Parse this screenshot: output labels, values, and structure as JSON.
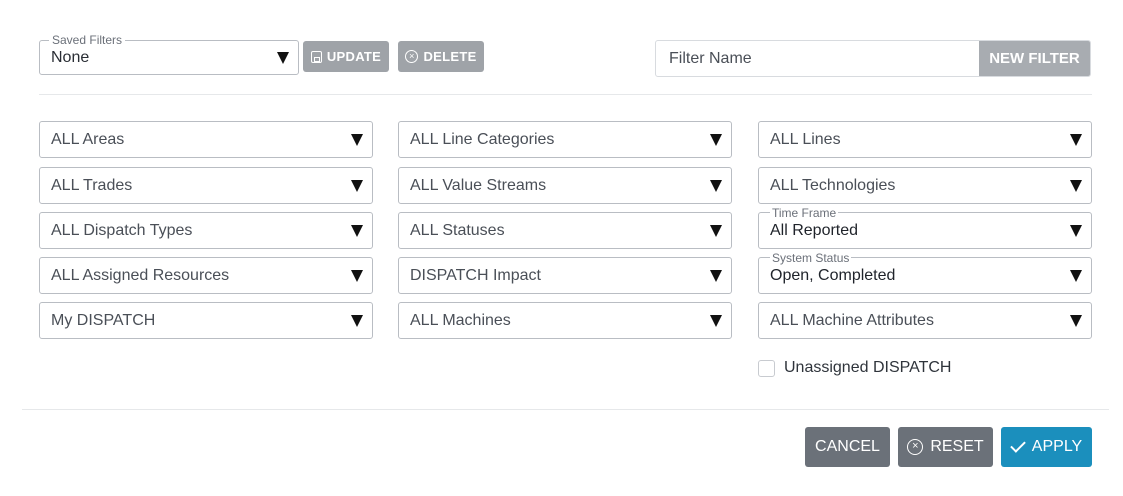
{
  "saved_filters": {
    "legend": "Saved Filters",
    "value": "None",
    "update_label": "UPDATE",
    "delete_label": "DELETE"
  },
  "new_filter": {
    "placeholder": "Filter Name",
    "button_label": "NEW FILTER"
  },
  "filters": {
    "areas": "ALL Areas",
    "line_categories": "ALL Line Categories",
    "lines": "ALL Lines",
    "trades": "ALL Trades",
    "value_streams": "ALL Value Streams",
    "technologies": "ALL Technologies",
    "dispatch_types": "ALL Dispatch Types",
    "statuses": "ALL Statuses",
    "time_frame": {
      "legend": "Time Frame",
      "value": "All Reported"
    },
    "assigned_resources": "ALL Assigned Resources",
    "dispatch_impact": "DISPATCH Impact",
    "system_status": {
      "legend": "System Status",
      "value": "Open, Completed"
    },
    "my_dispatch": "My DISPATCH",
    "machines": "ALL Machines",
    "machine_attributes": "ALL Machine Attributes"
  },
  "unassigned_checkbox": {
    "label": "Unassigned DISPATCH",
    "checked": false
  },
  "footer": {
    "cancel_label": "CANCEL",
    "reset_label": "RESET",
    "apply_label": "APPLY"
  },
  "colors": {
    "apply": "#1b8fbd",
    "footer_button": "#6b7179",
    "disabled_button": "#9fa3a8"
  },
  "icons": {
    "dropdown": "triangle-down-icon",
    "update": "save-icon",
    "delete": "x-circle-icon",
    "reset": "x-circle-icon",
    "apply": "check-icon"
  }
}
